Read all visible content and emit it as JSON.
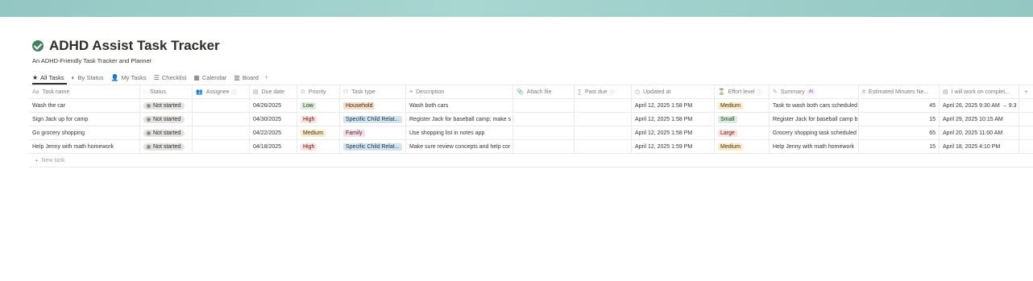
{
  "header": {
    "title": "ADHD Assist Task Tracker",
    "subtitle": "An ADHD-Friendly Task Tracker and Planner"
  },
  "tabs": [
    {
      "label": "All Tasks",
      "icon": "star-icon"
    },
    {
      "label": "By Status",
      "icon": "status-icon"
    },
    {
      "label": "My Tasks",
      "icon": "person-icon"
    },
    {
      "label": "Checklist",
      "icon": "checklist-icon"
    },
    {
      "label": "Calendar",
      "icon": "calendar-icon"
    },
    {
      "label": "Board",
      "icon": "board-icon"
    }
  ],
  "table": {
    "columns": [
      "Task name",
      "Status",
      "Assignee",
      "Due date",
      "Priority",
      "Task type",
      "Description",
      "Attach file",
      "Past due",
      "Updated at",
      "Effort level",
      "Summary",
      "Estimated Minutes Ne...",
      "I will work on complet..."
    ],
    "ai_badge": "AI",
    "rows": [
      {
        "task": "Wash the car",
        "status": "Not started",
        "due": "04/26/2025",
        "priority": "Low",
        "type": "Household",
        "description": "Wash both cars",
        "updated": "April 12, 2025 1:58 PM",
        "effort": "Medium",
        "summary": "Task to wash both cars scheduled",
        "minutes": "45",
        "work_on": "April 26, 2025 9:30 AM → 9:3"
      },
      {
        "task": "Sign Jack up for camp",
        "status": "Not started",
        "due": "04/30/2025",
        "priority": "High",
        "type": "Specific Child Relat...",
        "description": "Register Jack for baseball camp; make s",
        "updated": "April 12, 2025 1:58 PM",
        "effort": "Small",
        "summary": "Register Jack for baseball camp b",
        "minutes": "15",
        "work_on": "April 29, 2025 10:15 AM"
      },
      {
        "task": "Go grocery shopping",
        "status": "Not started",
        "due": "04/22/2025",
        "priority": "Medium",
        "type": "Family",
        "description": "Use shopping list in notes app",
        "updated": "April 12, 2025 1:58 PM",
        "effort": "Large",
        "summary": "Grocery shopping task scheduled",
        "minutes": "65",
        "work_on": "April 20, 2025 11:00 AM"
      },
      {
        "task": "Help Jenny with math homework",
        "status": "Not started",
        "due": "04/18/2025",
        "priority": "High",
        "type": "Specific Child Relat...",
        "description": "Make sure review concepts and help cor",
        "updated": "April 12, 2025 1:59 PM",
        "effort": "Medium",
        "summary": "Help Jenny with math homework",
        "minutes": "15",
        "work_on": "April 18, 2025 4:10 PM"
      }
    ],
    "new_row_label": "New task"
  },
  "colors": {
    "cover": "#a3d2cd",
    "title_check": "#448361",
    "tag_low_bg": "#dbeddb",
    "tag_low_fg": "#1c3829",
    "tag_high_bg": "#ffe2dd",
    "tag_high_fg": "#5d1715",
    "tag_medium_bg": "#fdecc8",
    "tag_medium_fg": "#402c1b",
    "tag_household_bg": "#fadec9",
    "tag_household_fg": "#49290e",
    "tag_child_bg": "#d3e5ef",
    "tag_child_fg": "#183347",
    "tag_family_bg": "#f5e0e9",
    "tag_family_fg": "#4c2337",
    "tag_small_bg": "#dbeddb",
    "tag_large_bg": "#ffe2dd"
  }
}
